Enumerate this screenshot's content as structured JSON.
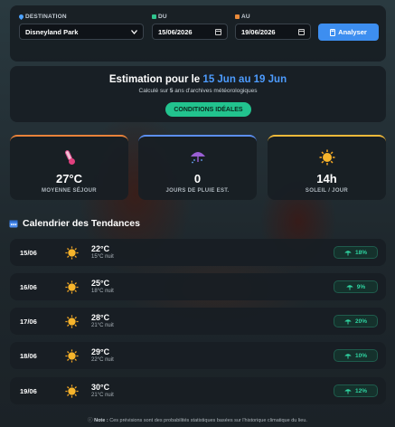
{
  "search": {
    "destination_label": "DESTINATION",
    "destination_value": "Disneyland Park",
    "from_label": "DU",
    "from_value": "15/06/2026",
    "to_label": "AU",
    "to_value": "19/06/2026",
    "analyze_label": "Analyser"
  },
  "summary": {
    "title_prefix": "Estimation pour le",
    "range": "15 Jun au 19 Jun",
    "subtitle_prefix": "Calculé sur",
    "subtitle_years": "5",
    "subtitle_suffix": "ans d'archives météorologiques",
    "badge": "CONDITIONS IDÉALES"
  },
  "stats": [
    {
      "value": "27°C",
      "caption": "MOYENNE SÉJOUR",
      "icon": "thermometer-icon",
      "accent": "#e8823a"
    },
    {
      "value": "0",
      "caption": "JOURS DE PLUIE EST.",
      "icon": "umbrella-icon",
      "accent": "#5c8ff2"
    },
    {
      "value": "14h",
      "caption": "SOLEIL / JOUR",
      "icon": "sun-icon",
      "accent": "#f0b93a"
    }
  ],
  "calendar_title": "Calendrier des Tendances",
  "days": [
    {
      "date": "15/06",
      "temp": "22°C",
      "night": "15°C nuit",
      "rain": "18%"
    },
    {
      "date": "16/06",
      "temp": "25°C",
      "night": "18°C nuit",
      "rain": "9%"
    },
    {
      "date": "17/06",
      "temp": "28°C",
      "night": "21°C nuit",
      "rain": "20%"
    },
    {
      "date": "18/06",
      "temp": "29°C",
      "night": "22°C nuit",
      "rain": "10%"
    },
    {
      "date": "19/06",
      "temp": "30°C",
      "night": "21°C nuit",
      "rain": "12%"
    }
  ],
  "footer": {
    "label": "Note :",
    "text": "Ces prévisions sont des probabilités statistiques basées sur l'historique climatique du lieu."
  },
  "colors": {
    "accent_blue": "#3d8ef0",
    "badge_green": "#22c38e",
    "rain_green": "#2ed3a0",
    "panel": "#181e24"
  }
}
